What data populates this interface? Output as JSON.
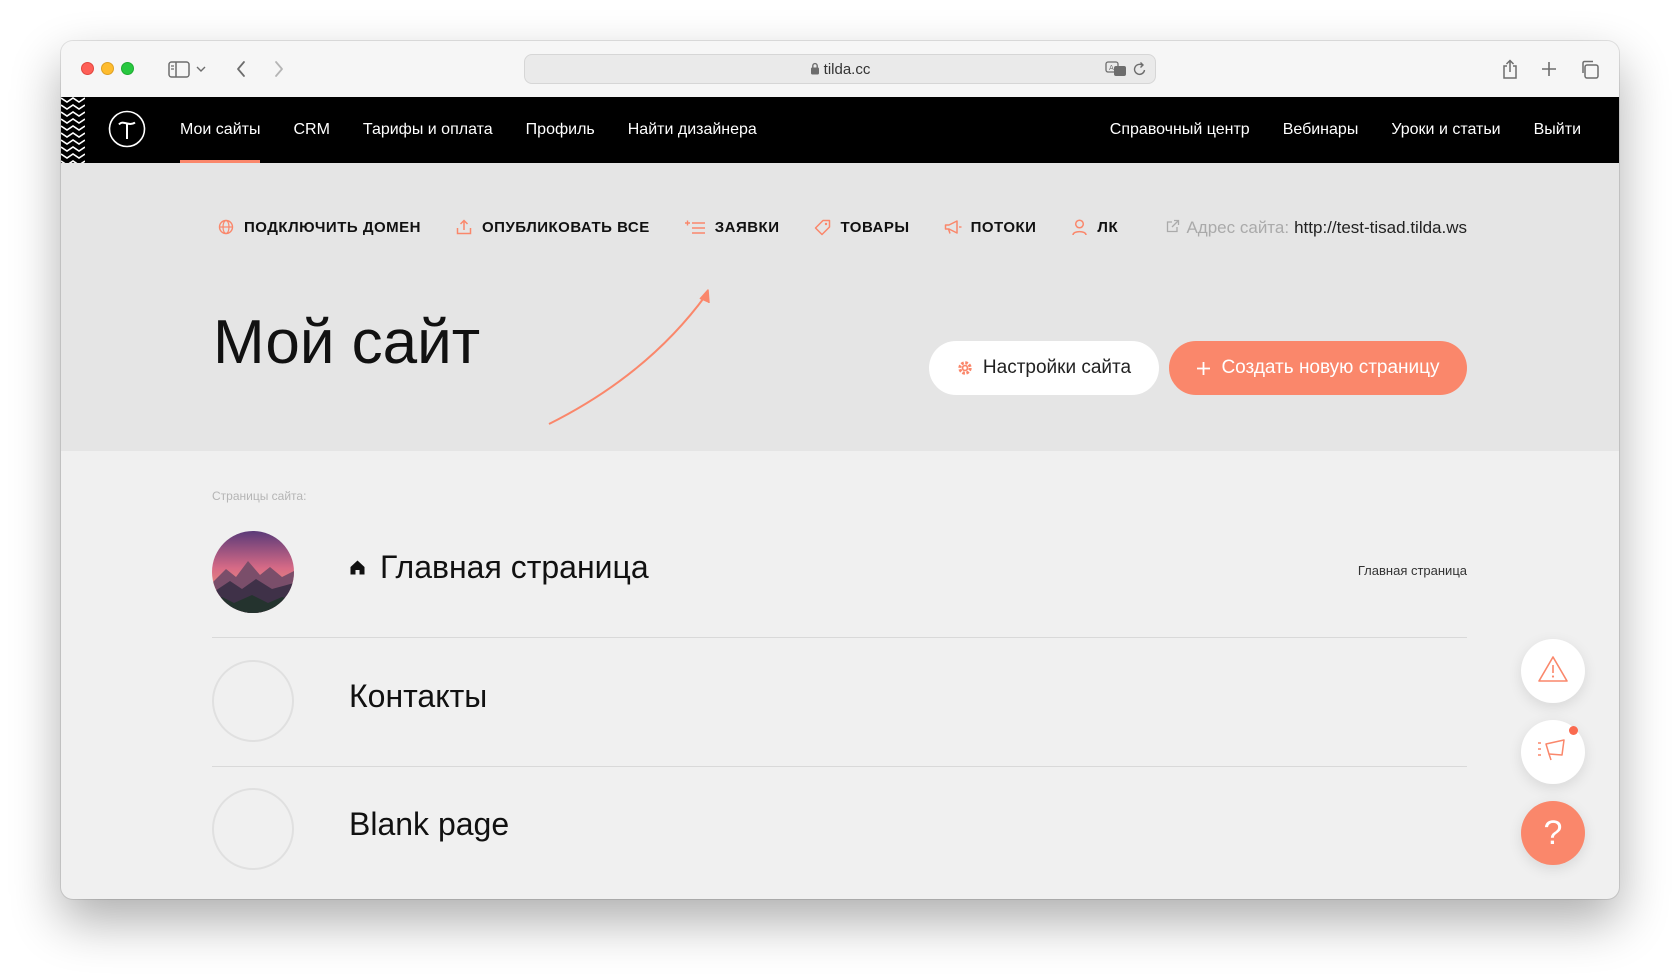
{
  "browser": {
    "url": "tilda.cc",
    "icons": [
      "sidebar-icon",
      "chevron-down-icon",
      "back-icon",
      "forward-icon",
      "translate-icon",
      "reload-icon",
      "share-icon",
      "new-tab-icon",
      "tabs-overview-icon",
      "lock-icon"
    ]
  },
  "nav": {
    "left": [
      {
        "label": "Мои сайты",
        "active": true
      },
      {
        "label": "CRM"
      },
      {
        "label": "Тарифы и оплата"
      },
      {
        "label": "Профиль"
      },
      {
        "label": "Найти дизайнера"
      }
    ],
    "right": [
      {
        "label": "Справочный центр"
      },
      {
        "label": "Вебинары"
      },
      {
        "label": "Уроки и статьи"
      },
      {
        "label": "Выйти"
      }
    ]
  },
  "actions": [
    {
      "label": "ПОДКЛЮЧИТЬ ДОМЕН",
      "icon": "globe-icon"
    },
    {
      "label": "ОПУБЛИКОВАТЬ ВСЕ",
      "icon": "upload-icon"
    },
    {
      "label": "ЗАЯВКИ",
      "icon": "list-plus-icon"
    },
    {
      "label": "ТОВАРЫ",
      "icon": "tag-icon"
    },
    {
      "label": "ПОТОКИ",
      "icon": "megaphone-icon"
    },
    {
      "label": "ЛК",
      "icon": "user-icon"
    }
  ],
  "site_address": {
    "label": "Адрес сайта:",
    "value": "http://test-tisad.tilda.ws"
  },
  "project": {
    "title": "Мой сайт",
    "settings_button": "Настройки сайта",
    "create_button": "Создать новую страницу"
  },
  "pages": {
    "label": "Страницы сайта:",
    "items": [
      {
        "name": "Главная страница",
        "tag": "Главная страница",
        "is_home": true,
        "has_thumb": true
      },
      {
        "name": "Контакты",
        "tag": ""
      },
      {
        "name": "Blank page",
        "tag": ""
      }
    ]
  },
  "floating": {
    "help": "?",
    "icons": [
      "warning-icon",
      "announcement-icon",
      "help-icon"
    ]
  },
  "colors": {
    "accent": "#fa876b",
    "nav_bg": "#000000",
    "header_bg": "#e5e5e5",
    "body_bg": "#f0f0f0"
  }
}
